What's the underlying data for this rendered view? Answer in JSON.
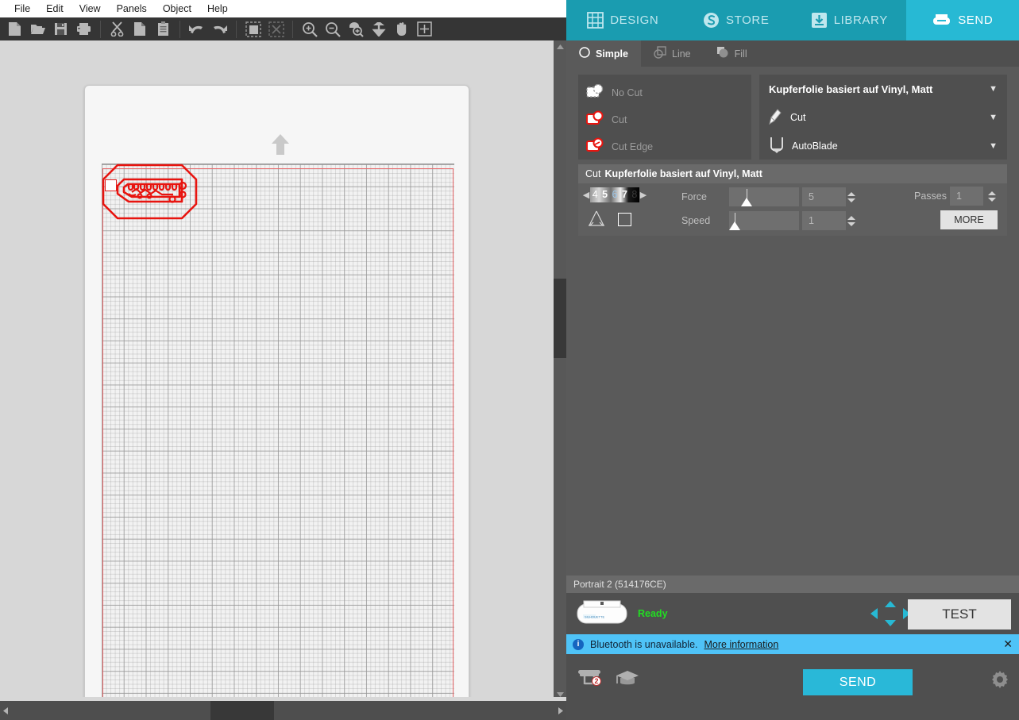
{
  "menu": {
    "items": [
      "File",
      "Edit",
      "View",
      "Panels",
      "Object",
      "Help"
    ]
  },
  "toolbar": {
    "groups": [
      [
        {
          "name": "new-document-icon",
          "label": "New"
        },
        {
          "name": "open-folder-icon",
          "label": "Open"
        },
        {
          "name": "save-icon",
          "label": "Save"
        },
        {
          "name": "print-icon",
          "label": "Print"
        }
      ],
      [
        {
          "name": "cut-scissors-icon",
          "label": "Cut"
        },
        {
          "name": "copy-icon",
          "label": "Copy"
        },
        {
          "name": "paste-clipboard-icon",
          "label": "Paste"
        }
      ],
      [
        {
          "name": "undo-icon",
          "label": "Undo"
        },
        {
          "name": "redo-icon",
          "label": "Redo"
        }
      ],
      [
        {
          "name": "select-all-icon",
          "label": "Select All"
        },
        {
          "name": "deselect-all-icon",
          "label": "Deselect All"
        }
      ],
      [
        {
          "name": "zoom-in-icon",
          "label": "Zoom In"
        },
        {
          "name": "zoom-out-icon",
          "label": "Zoom Out"
        },
        {
          "name": "zoom-selection-icon",
          "label": "Zoom to Selection"
        },
        {
          "name": "fit-to-page-icon",
          "label": "Fit to Page"
        },
        {
          "name": "pan-hand-icon",
          "label": "Pan"
        },
        {
          "name": "show-grid-icon",
          "label": "Grid"
        }
      ]
    ]
  },
  "tabs": [
    {
      "label": "DESIGN",
      "icon": "grid-icon",
      "active": false
    },
    {
      "label": "STORE",
      "icon": "store-icon",
      "active": false
    },
    {
      "label": "LIBRARY",
      "icon": "download-icon",
      "active": false
    },
    {
      "label": "SEND",
      "icon": "cutter-icon",
      "active": true
    }
  ],
  "subtabs": [
    {
      "label": "Simple",
      "icon": "circle-icon",
      "active": true
    },
    {
      "label": "Line",
      "icon": "line-layers-icon",
      "active": false
    },
    {
      "label": "Fill",
      "icon": "fill-shapes-icon",
      "active": false
    }
  ],
  "actions": [
    {
      "label": "No Cut",
      "icon": "no-cut-icon",
      "selected": false
    },
    {
      "label": "Cut",
      "icon": "cut-icon",
      "selected": true
    },
    {
      "label": "Cut Edge",
      "icon": "cut-edge-icon",
      "selected": false
    }
  ],
  "material": {
    "name": "Kupferfolie basiert auf Vinyl, Matt",
    "action": "Cut",
    "action_icon": "blade-tip-icon",
    "tool": "AutoBlade",
    "tool_icon": "autoblade-icon",
    "caret": "▼"
  },
  "cut_settings": {
    "header_prefix": "Cut",
    "header_material": "Kupferfolie basiert auf Vinyl, Matt",
    "blade_depth": {
      "values": [
        "4",
        "5",
        "6",
        "7",
        "8"
      ],
      "selected": "7",
      "left_arrow": "◀",
      "right_arrow": "▶"
    },
    "force": {
      "label": "Force",
      "value": "5",
      "slider_pct": 22
    },
    "speed": {
      "label": "Speed",
      "value": "1",
      "slider_pct": 5
    },
    "passes": {
      "label": "Passes",
      "value": "1"
    },
    "more_label": "MORE"
  },
  "device": {
    "name": "Portrait 2 (514176CE)",
    "status": "Ready",
    "status_color": "#22dd22",
    "test_label": "TEST"
  },
  "notification": {
    "icon": "info-icon",
    "text": "Bluetooth is unavailable.",
    "link": "More information",
    "close": "✕"
  },
  "footer": {
    "send_label": "SEND",
    "cutter_badge": "2",
    "icons": [
      "cutter-queue-icon",
      "graduation-cap-icon",
      "gear-icon"
    ]
  },
  "canvas": {
    "page_orientation_icon": "page-up-arrow-icon",
    "design_name": "hdmi-connector-pcb-outline",
    "ruler_segments": 8
  },
  "colors": {
    "accent": "#27b9d4",
    "accent_dark": "#1a9cb0",
    "panel": "#5a5a5a",
    "cut_line": "#e02020",
    "notification": "#4fc3f7"
  }
}
